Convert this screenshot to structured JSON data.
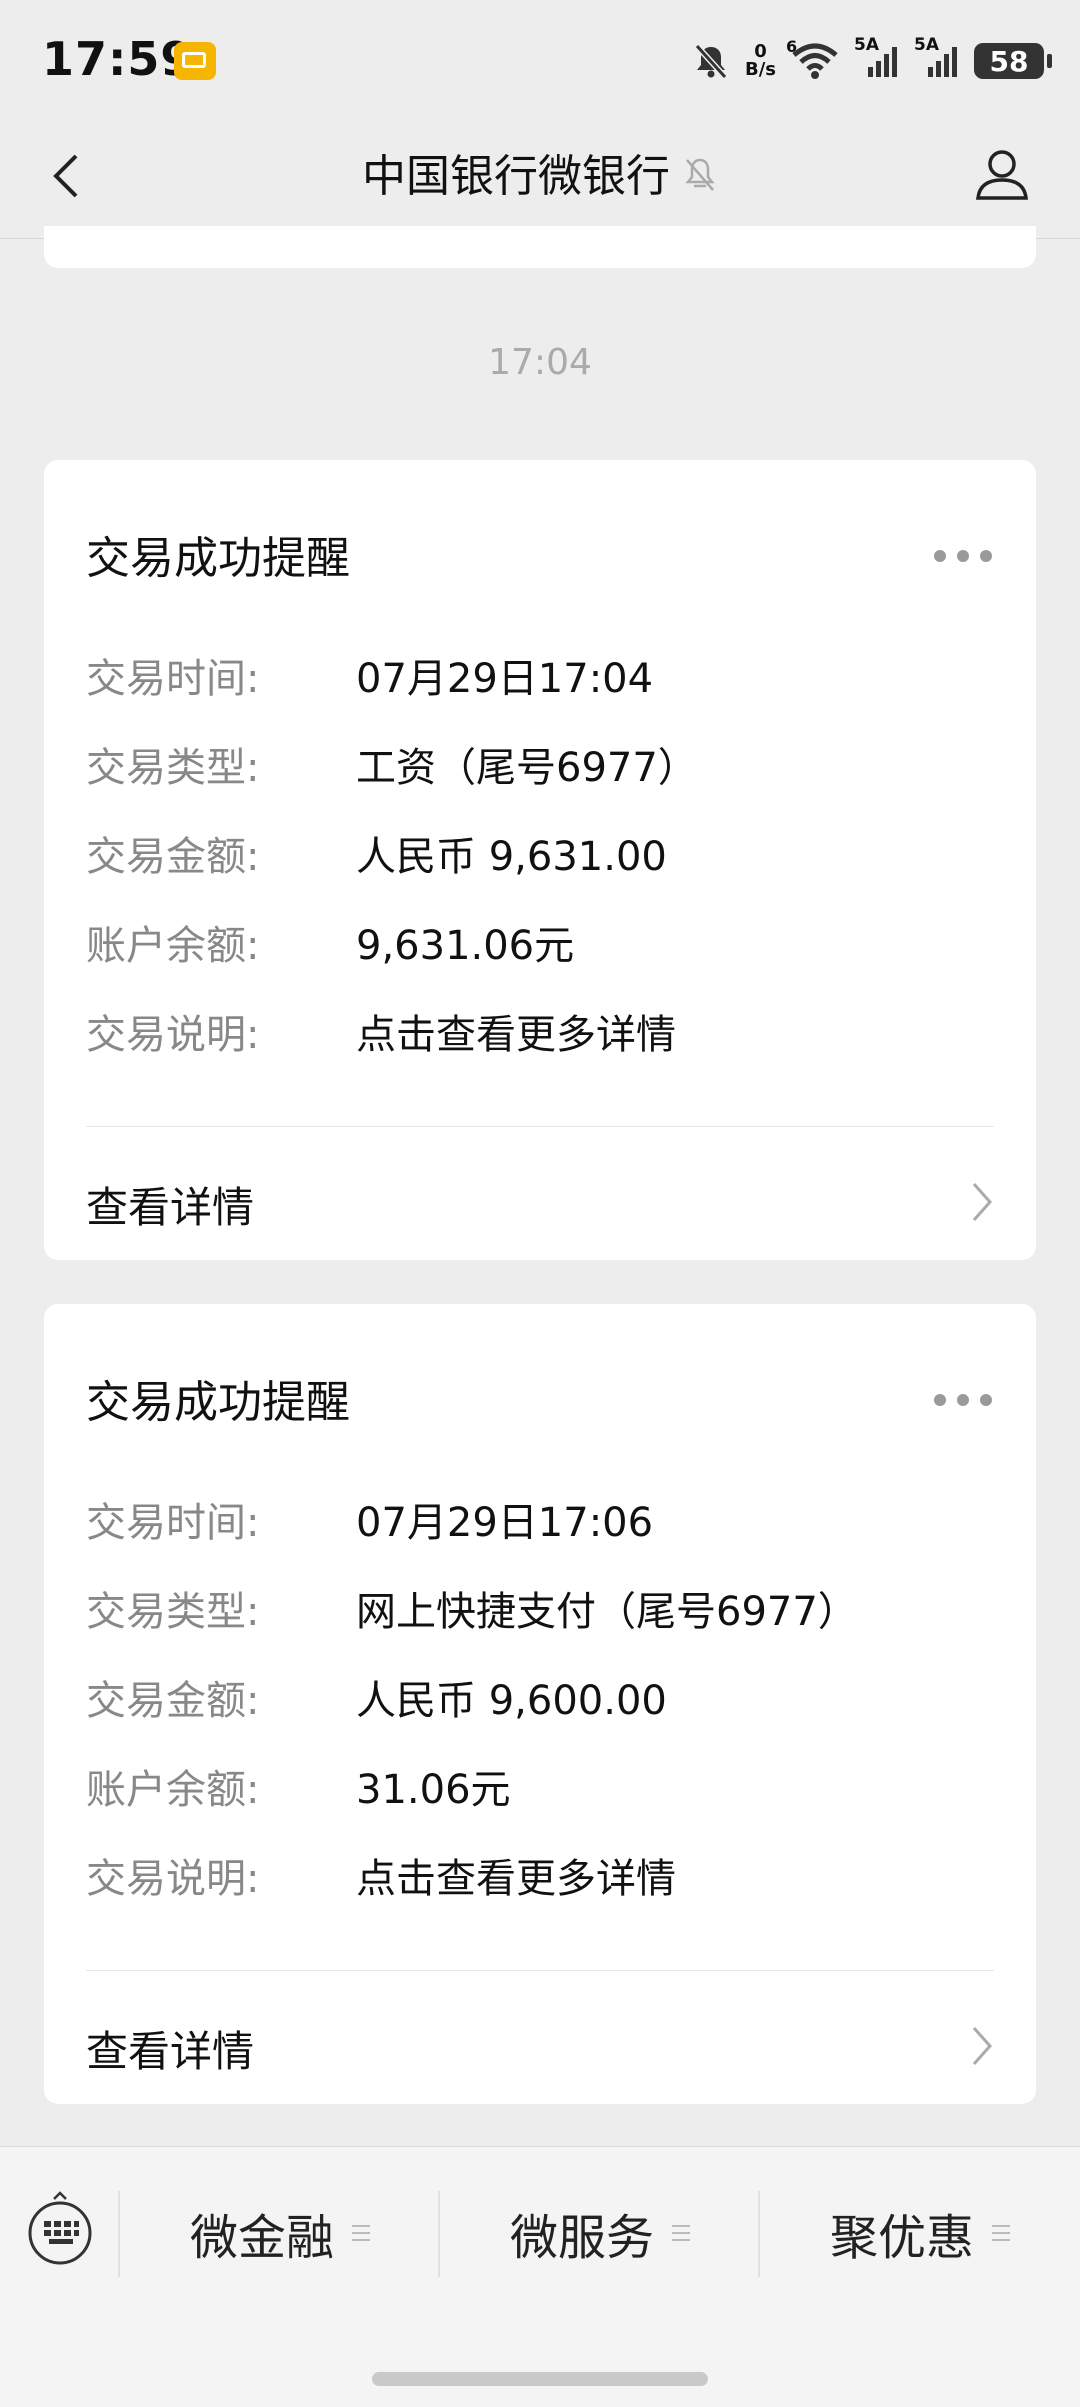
{
  "status_bar": {
    "time": "17:59",
    "net_speed_value": "0",
    "net_speed_unit": "B/s",
    "wifi_tag": "6",
    "sim1_tag": "5A",
    "sim2_tag": "5A",
    "battery": "58"
  },
  "nav": {
    "title": "中国银行微银行"
  },
  "chat": {
    "timestamp": "17:04",
    "messages": [
      {
        "title": "交易成功提醒",
        "rows": [
          {
            "label": "交易时间:",
            "value": "07月29日17:04"
          },
          {
            "label": "交易类型:",
            "value": "工资（尾号6977）"
          },
          {
            "label": "交易金额:",
            "value": "人民币 9,631.00"
          },
          {
            "label": "账户余额:",
            "value": "9,631.06元"
          },
          {
            "label": "交易说明:",
            "value": "点击查看更多详情"
          }
        ],
        "detail_link": "查看详情"
      },
      {
        "title": "交易成功提醒",
        "rows": [
          {
            "label": "交易时间:",
            "value": "07月29日17:06"
          },
          {
            "label": "交易类型:",
            "value": "网上快捷支付（尾号6977）"
          },
          {
            "label": "交易金额:",
            "value": "人民币 9,600.00"
          },
          {
            "label": "账户余额:",
            "value": "31.06元"
          },
          {
            "label": "交易说明:",
            "value": "点击查看更多详情"
          }
        ],
        "detail_link": "查看详情"
      }
    ]
  },
  "bottom_menu": {
    "items": [
      "微金融",
      "微服务",
      "聚优惠"
    ]
  }
}
